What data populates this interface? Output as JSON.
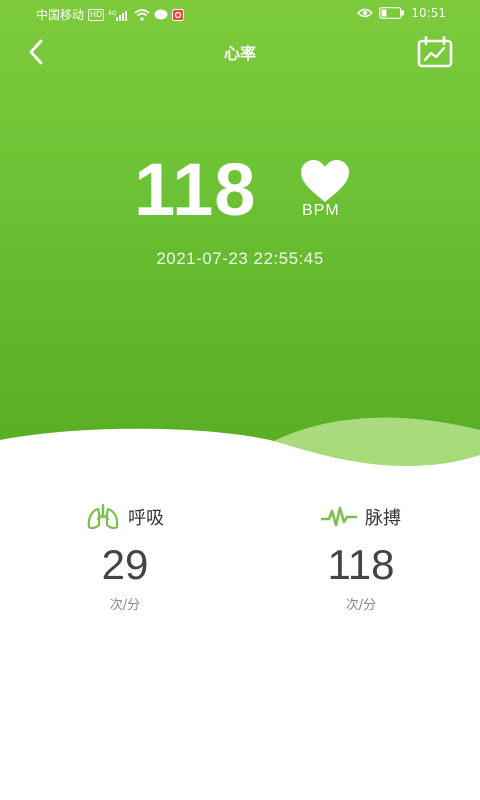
{
  "status_bar": {
    "carrier": "中国移动",
    "hd_badge": "HD",
    "signal_text": "⁴ᴳ",
    "battery_text": "",
    "time": "10:51"
  },
  "nav": {
    "title": "心率",
    "back_icon": "chevron-left-icon",
    "chart_icon": "calendar-chart-icon"
  },
  "measurement": {
    "bpm": "118",
    "unit": "BPM",
    "timestamp": "2021-07-23 22:55:45"
  },
  "stats": [
    {
      "label": "呼吸",
      "value": "29",
      "unit": "次/分",
      "icon": "lungs-icon"
    },
    {
      "label": "脉搏",
      "value": "118",
      "unit": "次/分",
      "icon": "pulse-wave-icon"
    }
  ],
  "colors": {
    "primary_green": "#6ec336",
    "icon_green": "#7cc04a",
    "white": "#ffffff"
  }
}
